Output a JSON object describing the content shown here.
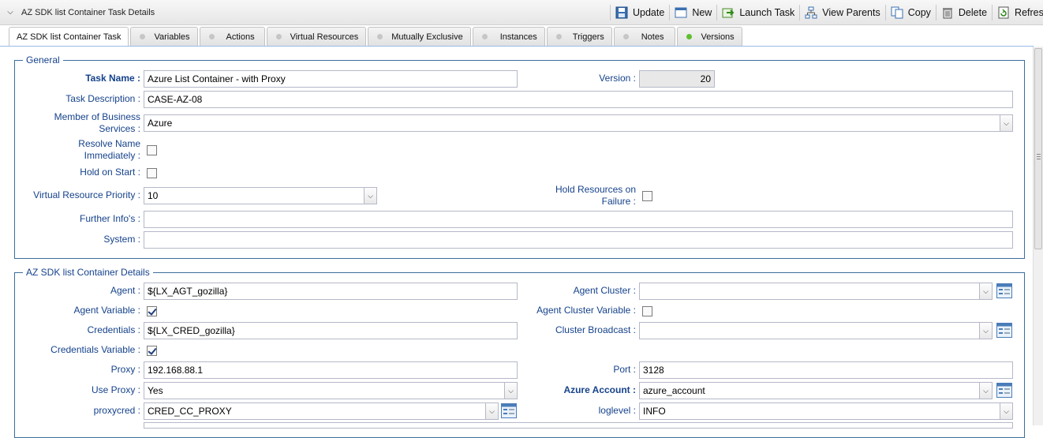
{
  "header": {
    "title": "AZ SDK list Container Task Details",
    "toolbar": [
      {
        "label": "Update",
        "icon": "save-icon"
      },
      {
        "label": "New",
        "icon": "new-window-icon"
      },
      {
        "label": "Launch Task",
        "icon": "launch-icon"
      },
      {
        "label": "View Parents",
        "icon": "hierarchy-icon"
      },
      {
        "label": "Copy",
        "icon": "copy-icon"
      },
      {
        "label": "Delete",
        "icon": "delete-icon"
      },
      {
        "label": "Refresh",
        "icon": "refresh-icon"
      }
    ]
  },
  "tabs": [
    {
      "label": "AZ SDK list Container Task",
      "active": true
    },
    {
      "label": "Variables"
    },
    {
      "label": "Actions"
    },
    {
      "label": "Virtual Resources"
    },
    {
      "label": "Mutually Exclusive"
    },
    {
      "label": "Instances"
    },
    {
      "label": "Triggers"
    },
    {
      "label": "Notes"
    },
    {
      "label": "Versions",
      "dot": "green"
    }
  ],
  "general": {
    "legend": "General",
    "task_name_label": "Task Name :",
    "task_name": "Azure List Container - with Proxy",
    "version_label": "Version :",
    "version": "20",
    "task_description_label": "Task Description :",
    "task_description": "CASE-AZ-08",
    "member_of_label_1": "Member of Business",
    "member_of_label_2": "Services :",
    "member_of": "Azure",
    "resolve_name_label_1": "Resolve Name",
    "resolve_name_label_2": "Immediately :",
    "resolve_name_checked": false,
    "hold_on_start_label": "Hold on Start :",
    "hold_on_start_checked": false,
    "vr_priority_label": "Virtual Resource Priority :",
    "vr_priority": "10",
    "hold_resources_label_1": "Hold Resources on",
    "hold_resources_label_2": "Failure :",
    "hold_resources_checked": false,
    "further_info_label": "Further Info's :",
    "further_info": "",
    "system_label": "System :",
    "system": ""
  },
  "details": {
    "legend": "AZ SDK list Container Details",
    "agent_label": "Agent :",
    "agent": "${LX_AGT_gozilla}",
    "agent_cluster_label": "Agent Cluster :",
    "agent_cluster": "",
    "agent_variable_label": "Agent Variable :",
    "agent_variable_checked": true,
    "agent_cluster_variable_label": "Agent Cluster Variable :",
    "agent_cluster_variable_checked": false,
    "credentials_label": "Credentials :",
    "credentials": "${LX_CRED_gozilla}",
    "cluster_broadcast_label": "Cluster Broadcast :",
    "cluster_broadcast": "",
    "credentials_variable_label": "Credentials Variable :",
    "credentials_variable_checked": true,
    "proxy_label": "Proxy :",
    "proxy": "192.168.88.1",
    "port_label": "Port :",
    "port": "3128",
    "use_proxy_label": "Use Proxy :",
    "use_proxy": "Yes",
    "azure_account_label": "Azure Account :",
    "azure_account": "azure_account",
    "proxycred_label": "proxycred :",
    "proxycred": "CRED_CC_PROXY",
    "loglevel_label": "loglevel :",
    "loglevel": "INFO"
  },
  "colors": {
    "label": "#15428b",
    "border": "#3b6e9c",
    "active_dot": "#5fbf2f"
  }
}
